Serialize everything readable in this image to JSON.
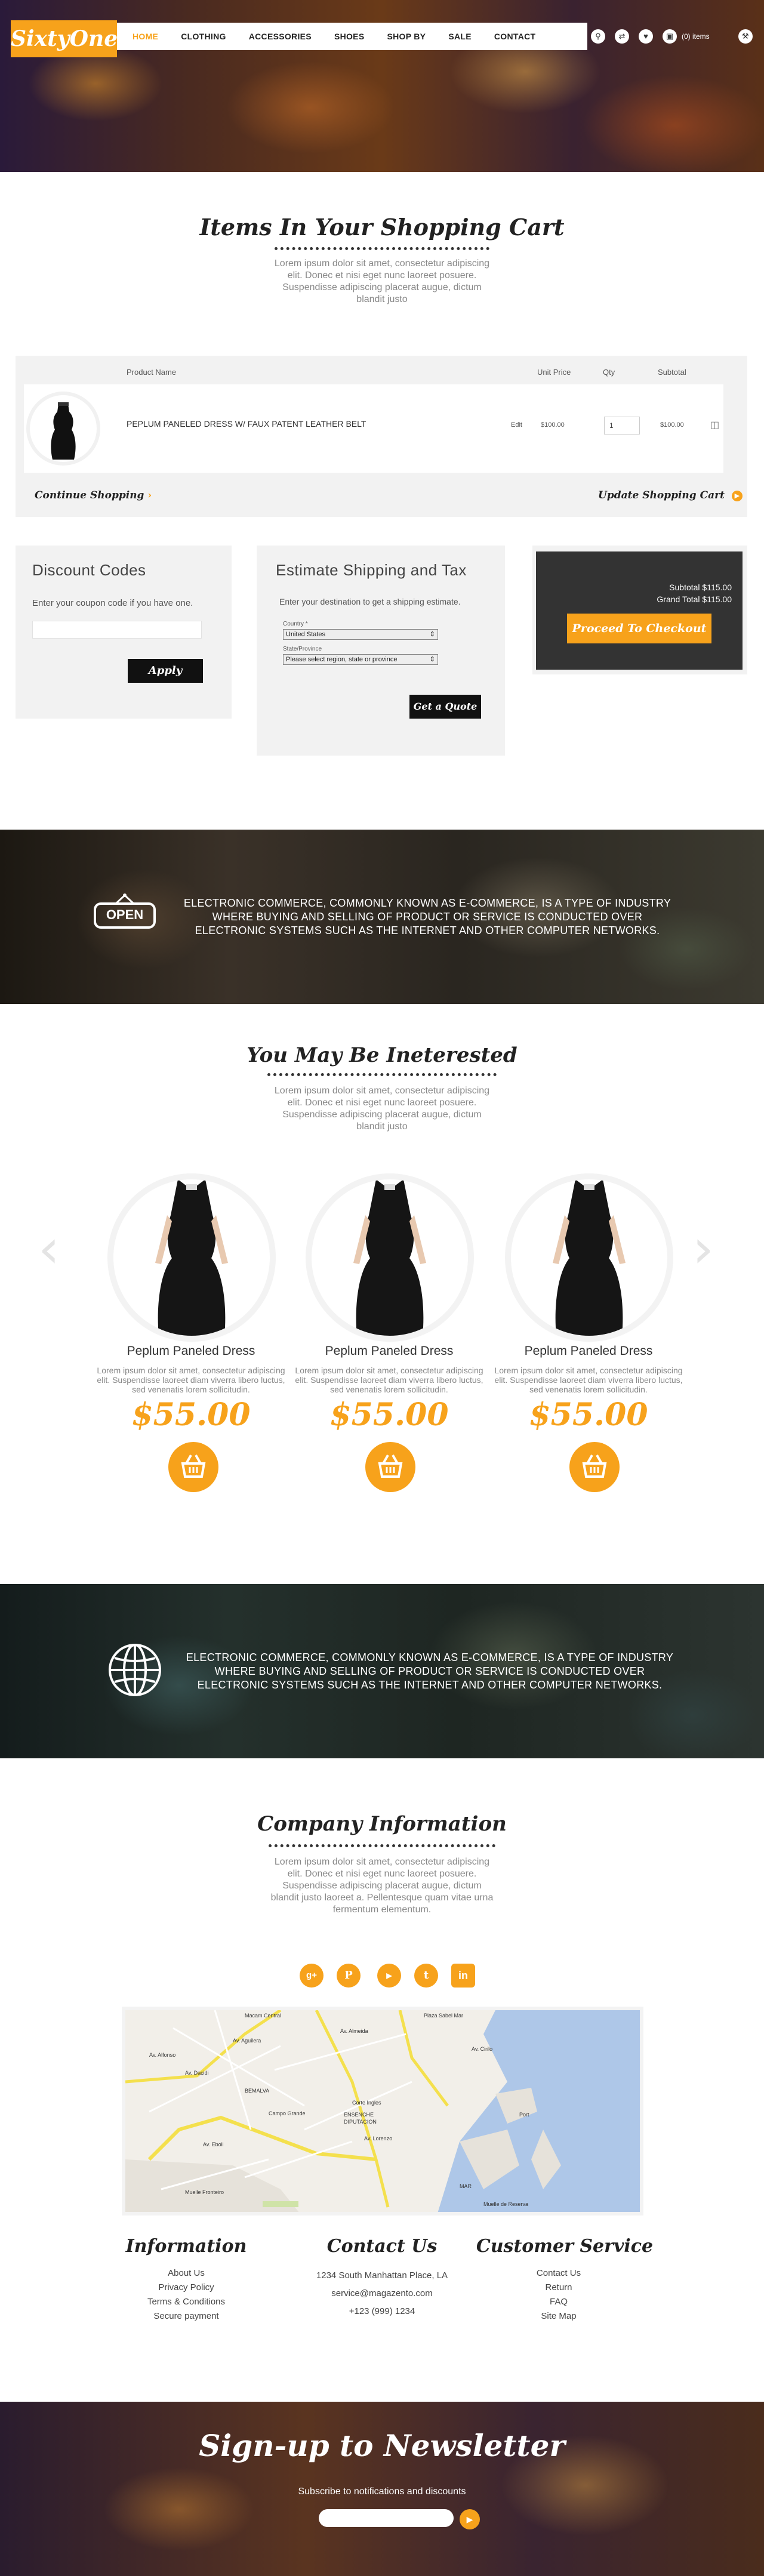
{
  "header": {
    "logo": "SixtyOne",
    "nav": [
      "HOME",
      "CLOTHING",
      "ACCESSORIES",
      "SHOES",
      "SHOP BY",
      "SALE",
      "CONTACT"
    ],
    "cart_count": "(0) items"
  },
  "cart": {
    "title": "Items In Your Shopping Cart",
    "intro": "Lorem ipsum dolor sit amet, consectetur adipiscing elit. Donec et nisi eget nunc laoreet posuere. Suspendisse adipiscing placerat augue, dictum blandit justo",
    "columns": [
      "Product Name",
      "Unit Price",
      "Qty",
      "Subtotal"
    ],
    "item": {
      "name": "PEPLUM PANELED DRESS W/ FAUX PATENT LEATHER BELT",
      "edit": "Edit",
      "unit_price": "$100.00",
      "qty": "1",
      "subtotal": "$100.00"
    },
    "continue_label": "Continue Shopping",
    "update_label": "Update Shopping Cart"
  },
  "discount": {
    "title": "Discount Codes",
    "text": "Enter your coupon code if you have one.",
    "button": "Apply"
  },
  "shipping": {
    "title": "Estimate Shipping and Tax",
    "text": "Enter your destination to get a shipping estimate.",
    "country_label": "Country *",
    "country_value": "United States",
    "state_label": "State/Province",
    "state_value": "Please select region, state or province",
    "button": "Get a Quote"
  },
  "totals": {
    "subtotal": "Subtotal $115.00",
    "grand_total": "Grand Total $115.00",
    "checkout": "Proceed To Checkout"
  },
  "banner1": {
    "sign": "OPEN",
    "text": "ELECTRONIC COMMERCE, COMMONLY KNOWN AS E-COMMERCE, IS A TYPE OF INDUSTRY WHERE BUYING AND SELLING OF PRODUCT OR SERVICE IS CONDUCTED OVER ELECTRONIC SYSTEMS SUCH AS THE INTERNET AND OTHER COMPUTER NETWORKS."
  },
  "interested": {
    "title": "You May Be Ineterested",
    "intro": "Lorem ipsum dolor sit amet, consectetur adipiscing elit. Donec et nisi eget nunc laoreet posuere. Suspendisse adipiscing placerat augue, dictum blandit justo",
    "products": [
      {
        "name": "Peplum Paneled Dress",
        "desc": "Lorem ipsum dolor sit amet, consectetur adipiscing elit. Suspendisse laoreet diam viverra libero luctus, sed venenatis lorem sollicitudin.",
        "price": "$55.00"
      },
      {
        "name": "Peplum Paneled Dress",
        "desc": "Lorem ipsum dolor sit amet, consectetur adipiscing elit. Suspendisse laoreet diam viverra libero luctus, sed venenatis lorem sollicitudin.",
        "price": "$55.00"
      },
      {
        "name": "Peplum Paneled Dress",
        "desc": "Lorem ipsum dolor sit amet, consectetur adipiscing elit. Suspendisse laoreet diam viverra libero luctus, sed venenatis lorem sollicitudin.",
        "price": "$55.00"
      }
    ]
  },
  "banner2": {
    "text": "ELECTRONIC COMMERCE, COMMONLY KNOWN AS E-COMMERCE, IS A TYPE OF INDUSTRY WHERE BUYING AND SELLING OF PRODUCT OR SERVICE IS CONDUCTED OVER ELECTRONIC SYSTEMS SUCH AS THE INTERNET AND OTHER COMPUTER NETWORKS."
  },
  "company": {
    "title": "Company Information",
    "intro": "Lorem ipsum dolor sit amet, consectetur adipiscing elit. Donec et nisi eget nunc laoreet posuere. Suspendisse adipiscing placerat augue, dictum blandit justo laoreet a. Pellentesque quam vitae urna fermentum elementum.",
    "social": [
      "g+",
      "p",
      "yt",
      "t",
      "in"
    ],
    "map_labels": [
      "Macam Central",
      "Av. Aguilera",
      "Av. Alfonso",
      "Av. Dacidi",
      "Av. Almeida",
      "BEMALVA",
      "Campo Grande",
      "Corte Ingles",
      "ENSENCHE",
      "DIPUTACION",
      "Av. Lorenzo",
      "Av. Eboli",
      "Muelle Fronteiro",
      "Av. Cirilo",
      "Plaza Sabel Mar",
      "Muelle de Reserva",
      "Port",
      "MAR"
    ]
  },
  "footer": {
    "information": {
      "title": "Information",
      "items": [
        "About Us",
        "Privacy Policy",
        "Terms & Conditions",
        "Secure payment"
      ]
    },
    "contact": {
      "title": "Contact Us",
      "items": [
        "1234 South Manhattan Place, LA",
        "service@magazento.com",
        "+123 (999) 1234"
      ]
    },
    "service": {
      "title": "Customer Service",
      "items": [
        "Contact Us",
        "Return",
        "FAQ",
        "Site Map"
      ]
    }
  },
  "newsletter": {
    "title": "Sign-up to Newsletter",
    "subtitle": "Subscribe to notifications and discounts",
    "input_value": ""
  },
  "colors": {
    "accent": "#f7a21b",
    "dark": "#111111"
  }
}
